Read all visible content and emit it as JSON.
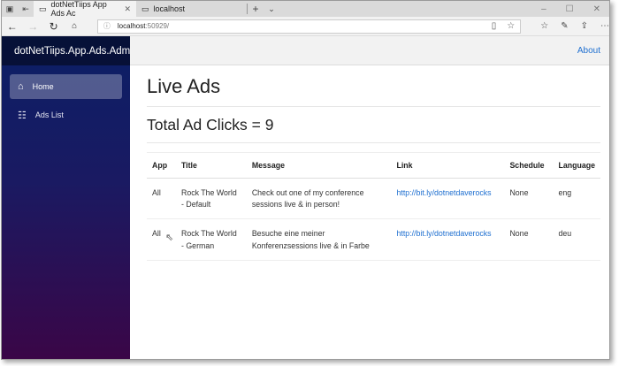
{
  "browser": {
    "tabs": [
      {
        "label": "dotNetTiips App Ads Ac",
        "active": true
      },
      {
        "label": "localhost",
        "active": false
      }
    ],
    "url_host": "localhost",
    "url_port": ":50929/"
  },
  "sidebar": {
    "brand": "dotNetTiips.App.Ads.Admin",
    "items": [
      {
        "label": "Home",
        "icon": "home-icon",
        "active": true
      },
      {
        "label": "Ads List",
        "icon": "list-icon",
        "active": false
      }
    ]
  },
  "topbar": {
    "about": "About"
  },
  "main": {
    "title": "Live Ads",
    "subtitle": "Total Ad Clicks = 9",
    "table": {
      "headers": [
        "App",
        "Title",
        "Message",
        "Link",
        "Schedule",
        "Language"
      ],
      "rows": [
        [
          "All",
          "Rock The World - Default",
          "Check out one of my conference sessions live & in person!",
          "http://bit.ly/dotnetdaverocks",
          "None",
          "eng"
        ],
        [
          "All",
          "Rock The World - German",
          "Besuche eine meiner Konferenzsessions live & in Farbe",
          "http://bit.ly/dotnetdaverocks",
          "None",
          "deu"
        ]
      ]
    }
  },
  "colors": {
    "link": "#1e6fd0",
    "sidebar_top": "#0b1f66",
    "sidebar_bottom": "#3a0647"
  }
}
